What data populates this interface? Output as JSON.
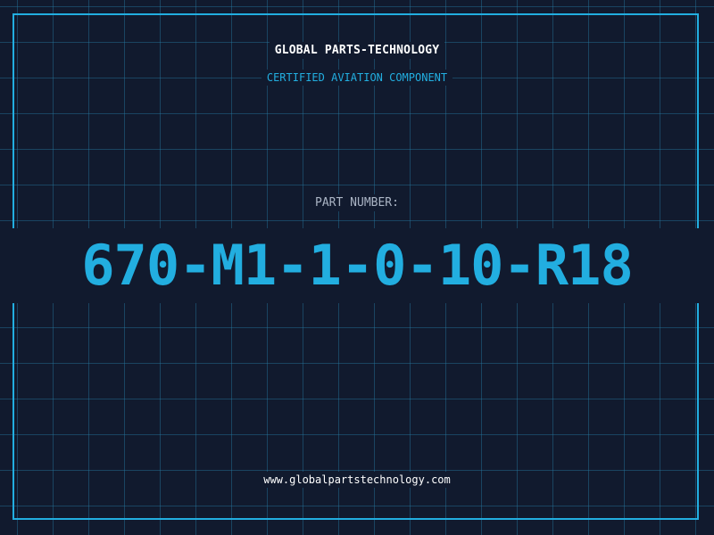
{
  "header": {
    "title": "GLOBAL PARTS-TECHNOLOGY",
    "subtitle": "CERTIFIED AVIATION COMPONENT"
  },
  "part": {
    "label": "PART NUMBER:",
    "number": "670-M1-1-0-10-R18"
  },
  "footer": {
    "url": "www.globalpartstechnology.com"
  },
  "colors": {
    "background": "#111a2e",
    "accent": "#22aee0",
    "grid": "#26789f",
    "title_text": "#ffffff",
    "label_text": "#aab4c4"
  }
}
